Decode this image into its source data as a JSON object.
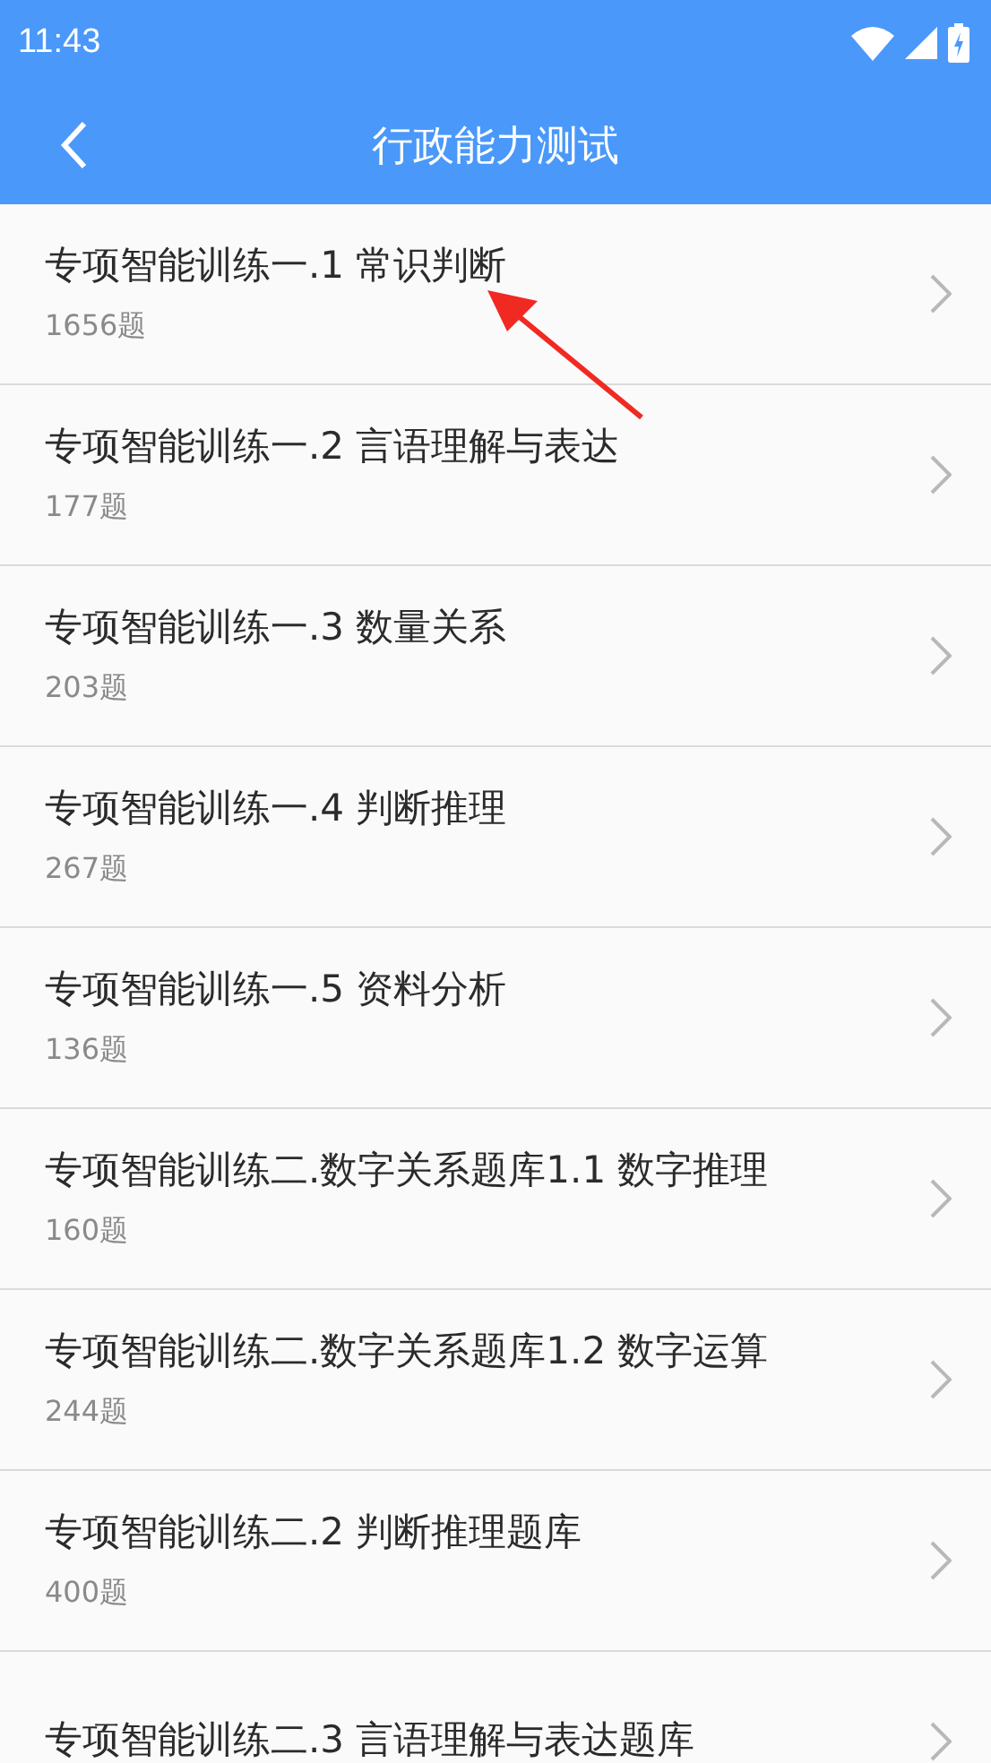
{
  "status_bar": {
    "time": "11:43"
  },
  "app_bar": {
    "title": "行政能力测试"
  },
  "items": [
    {
      "title": "专项智能训练一.1 常识判断",
      "count": "1656题"
    },
    {
      "title": "专项智能训练一.2 言语理解与表达",
      "count": "177题"
    },
    {
      "title": "专项智能训练一.3 数量关系",
      "count": "203题"
    },
    {
      "title": "专项智能训练一.4 判断推理",
      "count": "267题"
    },
    {
      "title": "专项智能训练一.5 资料分析",
      "count": "136题"
    },
    {
      "title": "专项智能训练二.数字关系题库1.1 数字推理",
      "count": "160题"
    },
    {
      "title": "专项智能训练二.数字关系题库1.2 数字运算",
      "count": "244题"
    },
    {
      "title": "专项智能训练二.2 判断推理题库",
      "count": "400题"
    },
    {
      "title": "专项智能训练二.3 言语理解与表达题库"
    }
  ]
}
